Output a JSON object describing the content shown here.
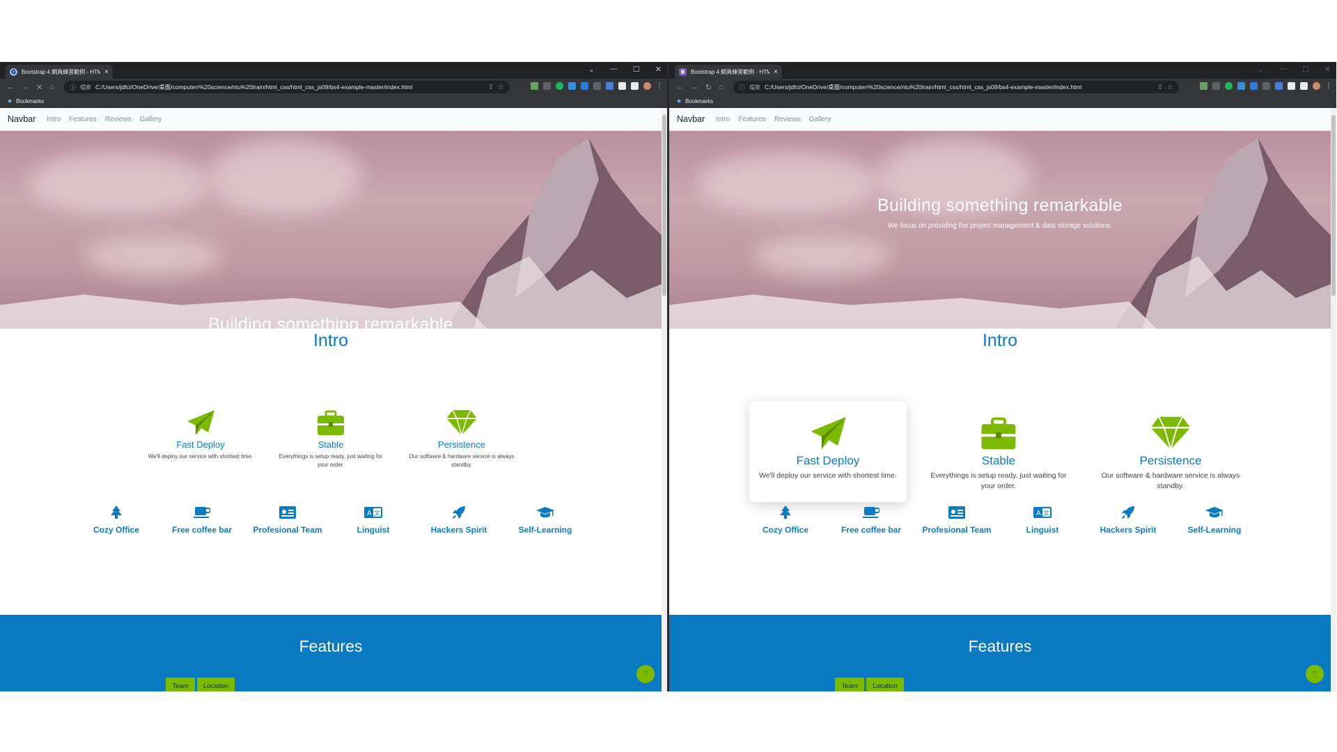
{
  "browser": {
    "tab_title": "Bootstrap 4 網頁練習範例 - HTM",
    "tab_close": "×",
    "address_scheme": "檔案",
    "url": "C:/Users/jdfci/OneDrive/桌面/computerr%20science/ntu%20train/html_css/html_css_js09/bs4-example-master/index.html",
    "bookmarks_label": "Bookmarks",
    "window_controls": [
      "⌄",
      "—",
      "☐",
      "✕"
    ]
  },
  "navbar": {
    "brand": "Navbar",
    "links": [
      "Intro",
      "Features",
      "Reviews",
      "Gallery"
    ]
  },
  "hero": {
    "title": "Building something remarkable",
    "subtitle": "We focus on providing the project management & data storage solutions."
  },
  "intro": {
    "title": "Intro",
    "features": [
      {
        "icon": "paper-plane-icon",
        "title": "Fast Deploy",
        "desc": "We'll deploy our service with shortest time."
      },
      {
        "icon": "briefcase-icon",
        "title": "Stable",
        "desc": "Everythings is setup ready, just waiting for your order."
      },
      {
        "icon": "diamond-icon",
        "title": "Persistence",
        "desc": "Our software & hardware service is always standby."
      }
    ],
    "perks": [
      {
        "icon": "tree-icon",
        "label": "Cozy Office"
      },
      {
        "icon": "coffee-icon",
        "label": "Free coffee bar"
      },
      {
        "icon": "id-card-icon",
        "label": "Profesional Team"
      },
      {
        "icon": "language-icon",
        "label": "Linguist"
      },
      {
        "icon": "rocket-icon",
        "label": "Hackers Spirit"
      },
      {
        "icon": "graduation-cap-icon",
        "label": "Self-Learning"
      }
    ]
  },
  "features_section": {
    "title": "Features",
    "buttons": [
      "Team",
      "Location"
    ]
  },
  "colors": {
    "accent_blue": "#0c7bc1",
    "accent_green": "#7cba00",
    "features_bg": "#0979c1"
  }
}
